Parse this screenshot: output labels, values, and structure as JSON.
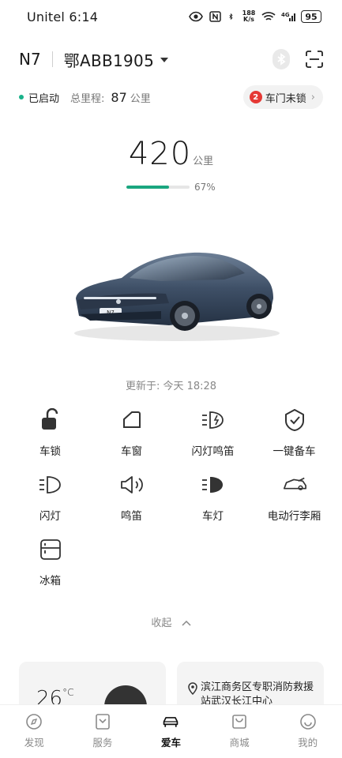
{
  "status_bar": {
    "carrier_time": "Unitel 6:14",
    "net_speed": "188 K/s",
    "signal_label": "4G",
    "battery": "95"
  },
  "header": {
    "model": "N7",
    "plate": "鄂ABB1905"
  },
  "status": {
    "state": "已启动",
    "odometer_label": "总里程:",
    "odometer_value": "87",
    "odometer_unit": "公里",
    "door_count": "2",
    "door_text": "车门未锁"
  },
  "range": {
    "value": "420",
    "unit": "公里",
    "percent_text": "67%",
    "percent": 0.67,
    "fill_color": "#1aa67f"
  },
  "updated": "更新于:  今天 18:28",
  "controls": [
    {
      "icon": "lock-open-icon",
      "label": "车锁"
    },
    {
      "icon": "window-icon",
      "label": "车窗"
    },
    {
      "icon": "flash-horn-icon",
      "label": "闪灯鸣笛"
    },
    {
      "icon": "shield-check-icon",
      "label": "一键备车"
    },
    {
      "icon": "flash-light-icon",
      "label": "闪灯"
    },
    {
      "icon": "horn-icon",
      "label": "鸣笛"
    },
    {
      "icon": "headlight-icon",
      "label": "车灯"
    },
    {
      "icon": "trunk-icon",
      "label": "电动行李厢"
    },
    {
      "icon": "fridge-icon",
      "label": "冰箱"
    }
  ],
  "collapse_label": "收起",
  "climate": {
    "temp": "26",
    "unit": "°C"
  },
  "location": {
    "text": "滨江商务区专职消防救援站武汉长江中心"
  },
  "nav": [
    {
      "icon": "discover-icon",
      "label": "发现",
      "active": false
    },
    {
      "icon": "service-icon",
      "label": "服务",
      "active": false
    },
    {
      "icon": "car-icon",
      "label": "爱车",
      "active": true
    },
    {
      "icon": "mall-icon",
      "label": "商城",
      "active": false
    },
    {
      "icon": "profile-icon",
      "label": "我的",
      "active": false
    }
  ]
}
